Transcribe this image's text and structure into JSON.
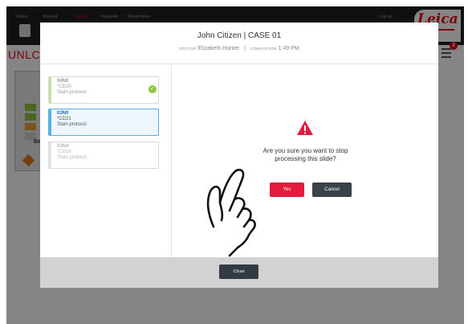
{
  "nav": {
    "tabs": [
      "Status",
      "Preload",
      "Unload",
      "Reagents",
      "Maintenance"
    ],
    "active_tab": "Unload",
    "logout_label": "Log out",
    "brand": "Leica"
  },
  "background": {
    "page_title": "UNLC",
    "rack_label": "Bes",
    "notification_count": "2"
  },
  "modal": {
    "title": "John Citizen | CASE 01",
    "subtitle": {
      "doctor_caption": "DOCTOR",
      "doctor_name": "Elizabeth Hunter",
      "separator": "|",
      "completion_caption": "COMPLETION",
      "completion_time": "1:49 PM"
    },
    "slides": [
      {
        "id": "04N0",
        "marker": "*CD20",
        "protocol": "Stain protocol",
        "state": "complete"
      },
      {
        "id": "03N0",
        "marker": "*CD21",
        "protocol": "Stain protocol",
        "state": "selected"
      },
      {
        "id": "02NA",
        "marker": "*CD16",
        "protocol": "Stain protocol",
        "state": "pending"
      }
    ],
    "confirm": {
      "line1": "Are you sure you want to stop",
      "line2": "processing this slide?",
      "yes_label": "Yes",
      "cancel_label": "Cancel"
    },
    "close_label": "Close",
    "close_icon": "×"
  },
  "colors": {
    "accent_red": "#e31c3d",
    "selected_blue": "#5aaee6",
    "complete_green": "#8cc63f",
    "dark_button": "#3b4148"
  },
  "icons": [
    "warning-triangle-icon",
    "check-circle-icon",
    "close-icon",
    "hand-pointer-icon",
    "menu-icon"
  ]
}
